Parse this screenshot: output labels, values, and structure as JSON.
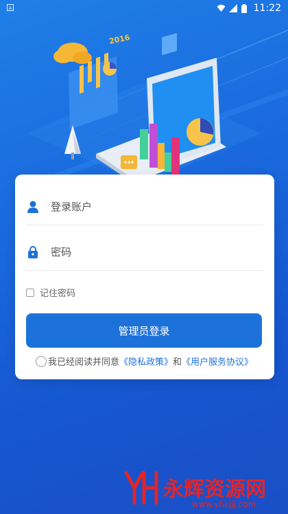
{
  "status_bar": {
    "left_icon": "android-notification-icon",
    "time": "11:22",
    "icons": [
      "wifi-icon",
      "signal-icon",
      "battery-icon"
    ]
  },
  "hero": {
    "illustration_text": "2016"
  },
  "login": {
    "account_placeholder": "登录账户",
    "password_placeholder": "密码",
    "remember_label": "记住密码",
    "login_button": "管理员登录",
    "agree_prefix": "我已经阅读并同意",
    "privacy_link": "《隐私政策》",
    "and": "和",
    "terms_link": "《用户服务协议》"
  },
  "colors": {
    "primary": "#1d72d9",
    "background": "#1a68dc",
    "watermark": "#e1252a"
  },
  "watermark": {
    "brand": "永辉资源网",
    "url": "www.yhkjjj.com"
  }
}
